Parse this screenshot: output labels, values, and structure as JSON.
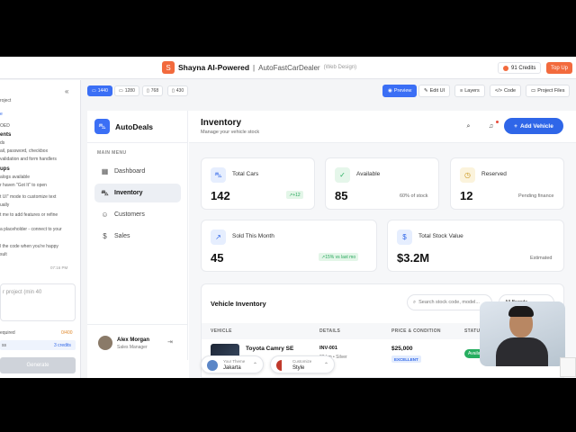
{
  "topbar": {
    "logo_glyph": "S",
    "title": "Shayna AI-Powered",
    "separator": " | ",
    "project": "AutoFastCarDealer",
    "project_type": "(Web Design)",
    "credits": "91 Credits",
    "topup": "Top Up"
  },
  "left_panel": {
    "lines": [
      "roject",
      "e",
      "OED",
      "ents",
      "ds",
      "ail, password, checkbox",
      "validation and form handlers",
      "ups",
      "alogs available",
      "r haven \"Got It\" to open",
      "t UI\" mode to customize text",
      "ually",
      "t me to add features or refine",
      "a placeholder - connect to your",
      "l the code when you're happy",
      "sult"
    ],
    "timestamp": "07:16 PM",
    "input_placeholder": "r project (min 40",
    "required_label": "equired",
    "required_count": "0/400",
    "cost_label": "ss",
    "cost_value": "3 credits",
    "generate": "Generate"
  },
  "toolbar": {
    "sizes": [
      "1440",
      "1280",
      "768",
      "430"
    ],
    "preview": "Preview",
    "edit": "Edit UI",
    "layers": "Layers",
    "code": "Code",
    "files": "Project Files"
  },
  "app": {
    "brand": "AutoDeals",
    "menu_label": "MAIN MENU",
    "nav": [
      "Dashboard",
      "Inventory",
      "Customers",
      "Sales"
    ],
    "user_name": "Alex Morgan",
    "user_role": "Sales Manager",
    "page_title": "Inventory",
    "page_subtitle": "Manage your vehicle stock",
    "add_button": "Add Vehicle",
    "stats": [
      {
        "label": "Total Cars",
        "value": "142",
        "badge": "+12"
      },
      {
        "label": "Available",
        "value": "85",
        "note": "60% of stock"
      },
      {
        "label": "Reserved",
        "value": "12",
        "note": "Pending finance"
      },
      {
        "label": "Sold This Month",
        "value": "45",
        "badge": "15% vs last mo"
      },
      {
        "label": "Total Stock Value",
        "value": "$3.2M",
        "note": "Estimated"
      }
    ],
    "inventory": {
      "title": "Vehicle Inventory",
      "search_placeholder": "Search stock code, model...",
      "brand_filter": "All Brands",
      "columns": [
        "VEHICLE",
        "DETAILS",
        "PRICE & CONDITION",
        "STATUS"
      ],
      "row": {
        "name": "Toyota Camry SE",
        "model": "Au",
        "code": "INV-001",
        "meta": "00 km • Silver",
        "price": "$25,000",
        "condition": "EXCELLENT",
        "status": "Availa"
      }
    },
    "theme_pill": {
      "label": "Your Theme",
      "value": "Jakarta"
    },
    "style_pill": {
      "label": "Customize",
      "value": "Style"
    }
  },
  "colors": {
    "accent": "#2f66e8",
    "brand_orange": "#f26a3d",
    "success": "#27ae60"
  }
}
